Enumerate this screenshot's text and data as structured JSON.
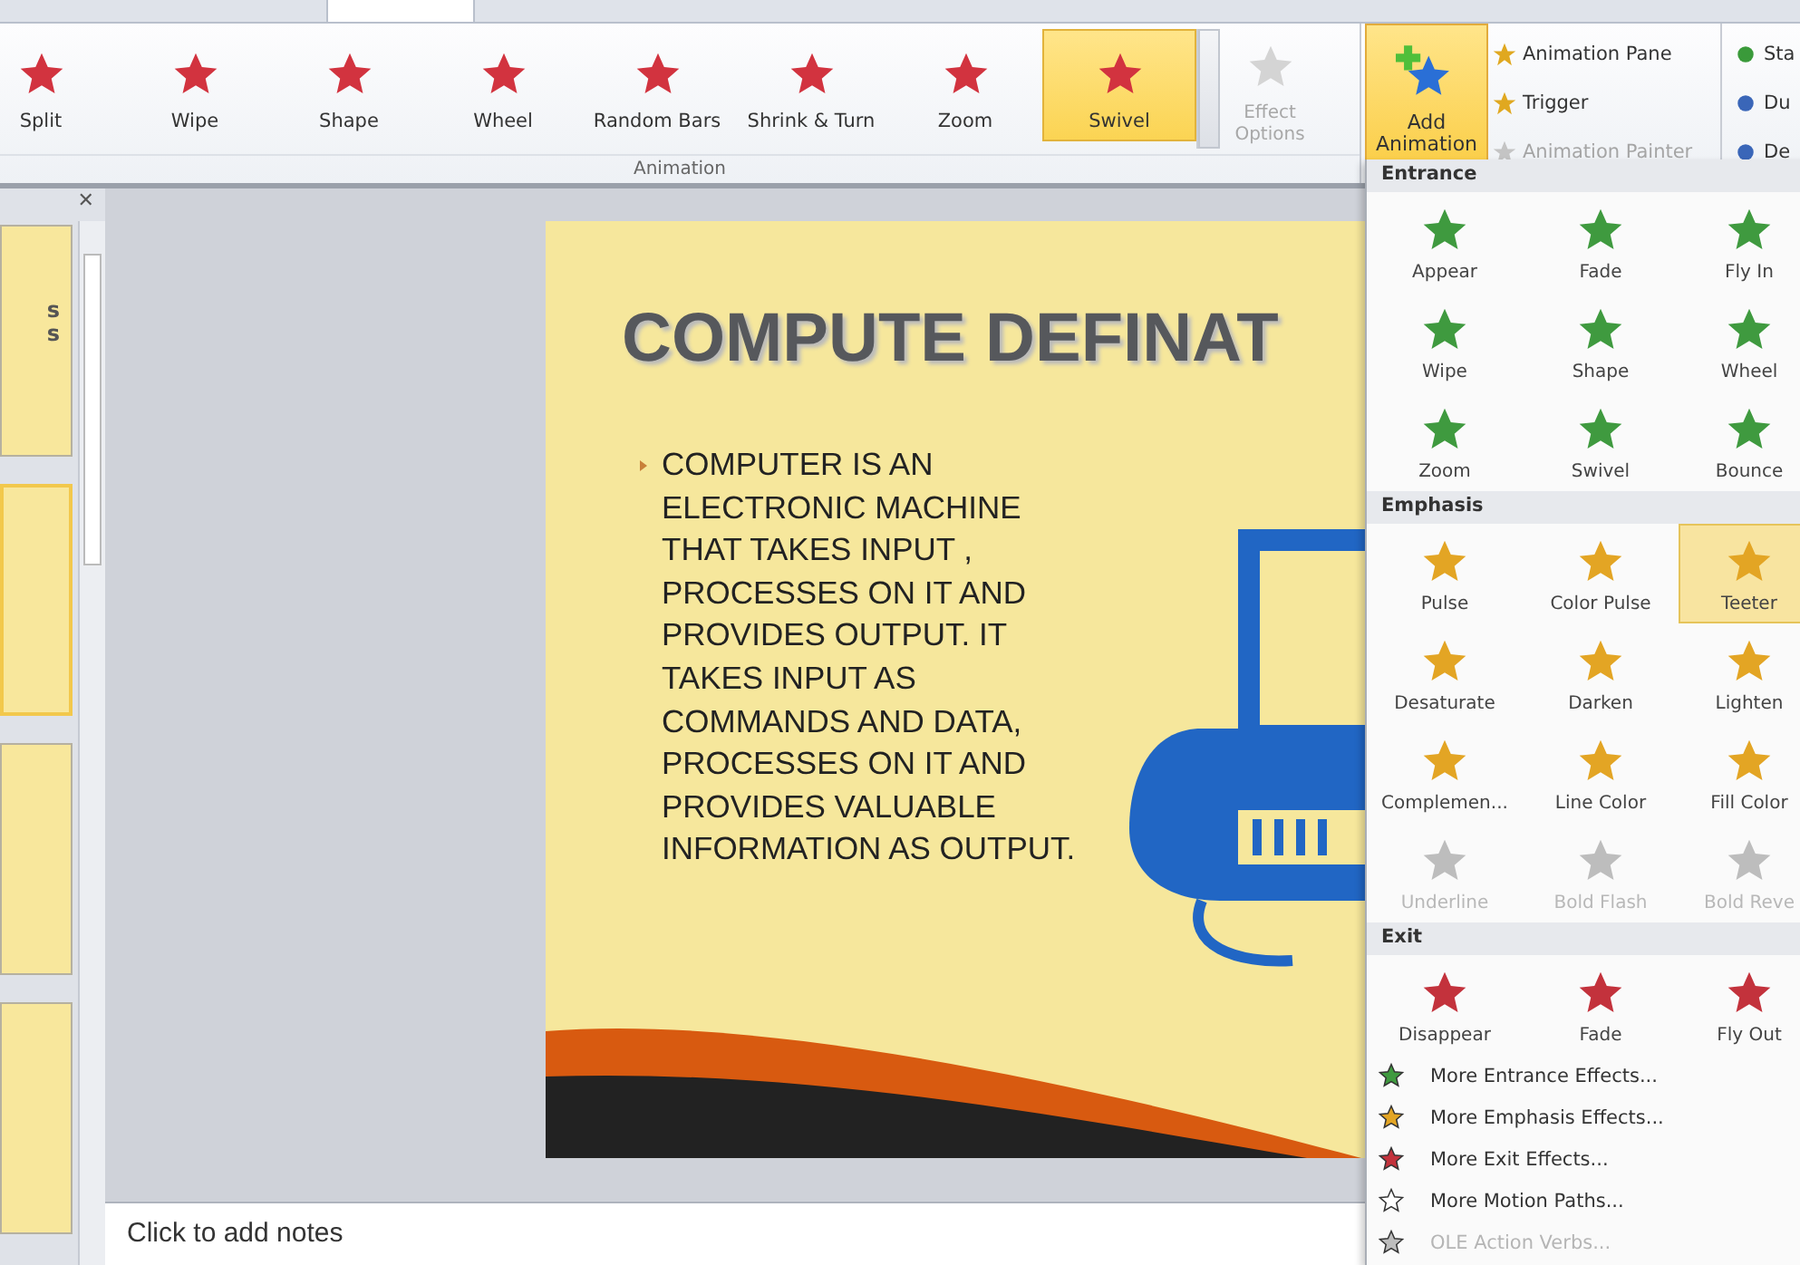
{
  "ribbon": {
    "gallery": [
      {
        "label": "Split",
        "selected": false
      },
      {
        "label": "Wipe",
        "selected": false
      },
      {
        "label": "Shape",
        "selected": false
      },
      {
        "label": "Wheel",
        "selected": false
      },
      {
        "label": "Random Bars",
        "selected": false
      },
      {
        "label": "Shrink & Turn",
        "selected": false
      },
      {
        "label": "Zoom",
        "selected": false
      },
      {
        "label": "Swivel",
        "selected": true
      }
    ],
    "effect_options": {
      "label": "Effect Options",
      "disabled": true
    },
    "group_label": "Animation",
    "add_animation": {
      "label": "Add Animation"
    },
    "advanced": [
      {
        "label": "Animation Pane",
        "disabled": false
      },
      {
        "label": "Trigger",
        "disabled": false
      },
      {
        "label": "Animation Painter",
        "disabled": true
      }
    ],
    "timing": [
      "Sta",
      "Du",
      "De"
    ]
  },
  "thumbnails": [
    {
      "lines": [
        "s",
        "s"
      ],
      "selected": false
    },
    {
      "selected": true
    },
    {
      "selected": false
    },
    {
      "selected": false
    }
  ],
  "thumbnail_pane": {
    "close": "✕"
  },
  "slide": {
    "title": "COMPUTE DEFINAT",
    "bullet": "COMPUTER  IS AN ELECTRONIC MACHINE  THAT TAKES INPUT  , PROCESSES ON IT AND  PROVIDES OUTPUT.  IT TAKES INPUT AS COMMANDS AND DATA, PROCESSES ON IT AND PROVIDES VALUABLE INFORMATION  AS OUTPUT."
  },
  "notes": {
    "placeholder": "Click to add notes"
  },
  "dropdown": {
    "sections": [
      {
        "title": "Entrance",
        "kind": "entrance",
        "effects": [
          {
            "label": "Appear",
            "selected": false,
            "disabled": false
          },
          {
            "label": "Fade",
            "selected": false,
            "disabled": false
          },
          {
            "label": "Fly In",
            "selected": false,
            "disabled": false
          },
          {
            "label": "Wipe",
            "selected": false,
            "disabled": false
          },
          {
            "label": "Shape",
            "selected": false,
            "disabled": false
          },
          {
            "label": "Wheel",
            "selected": false,
            "disabled": false
          },
          {
            "label": "Zoom",
            "selected": false,
            "disabled": false
          },
          {
            "label": "Swivel",
            "selected": false,
            "disabled": false
          },
          {
            "label": "Bounce",
            "selected": false,
            "disabled": false
          }
        ]
      },
      {
        "title": "Emphasis",
        "kind": "emphasis",
        "effects": [
          {
            "label": "Pulse",
            "selected": false,
            "disabled": false
          },
          {
            "label": "Color Pulse",
            "selected": false,
            "disabled": false
          },
          {
            "label": "Teeter",
            "selected": true,
            "disabled": false
          },
          {
            "label": "Desaturate",
            "selected": false,
            "disabled": false
          },
          {
            "label": "Darken",
            "selected": false,
            "disabled": false
          },
          {
            "label": "Lighten",
            "selected": false,
            "disabled": false
          },
          {
            "label": "Complemen...",
            "selected": false,
            "disabled": false
          },
          {
            "label": "Line Color",
            "selected": false,
            "disabled": false
          },
          {
            "label": "Fill Color",
            "selected": false,
            "disabled": false
          },
          {
            "label": "Underline",
            "selected": false,
            "disabled": true
          },
          {
            "label": "Bold Flash",
            "selected": false,
            "disabled": true
          },
          {
            "label": "Bold Reve",
            "selected": false,
            "disabled": true
          }
        ]
      },
      {
        "title": "Exit",
        "kind": "exit",
        "effects": [
          {
            "label": "Disappear",
            "selected": false,
            "disabled": false
          },
          {
            "label": "Fade",
            "selected": false,
            "disabled": false
          },
          {
            "label": "Fly Out",
            "selected": false,
            "disabled": false
          }
        ]
      }
    ],
    "more": [
      {
        "label": "More Entrance Effects...",
        "kind": "entrance",
        "disabled": false
      },
      {
        "label": "More Emphasis Effects...",
        "kind": "emphasis",
        "disabled": false
      },
      {
        "label": "More Exit Effects...",
        "kind": "exit",
        "disabled": false
      },
      {
        "label": "More Motion Paths...",
        "kind": "motion",
        "disabled": false
      },
      {
        "label": "OLE Action Verbs...",
        "kind": "ole",
        "disabled": true
      }
    ]
  }
}
